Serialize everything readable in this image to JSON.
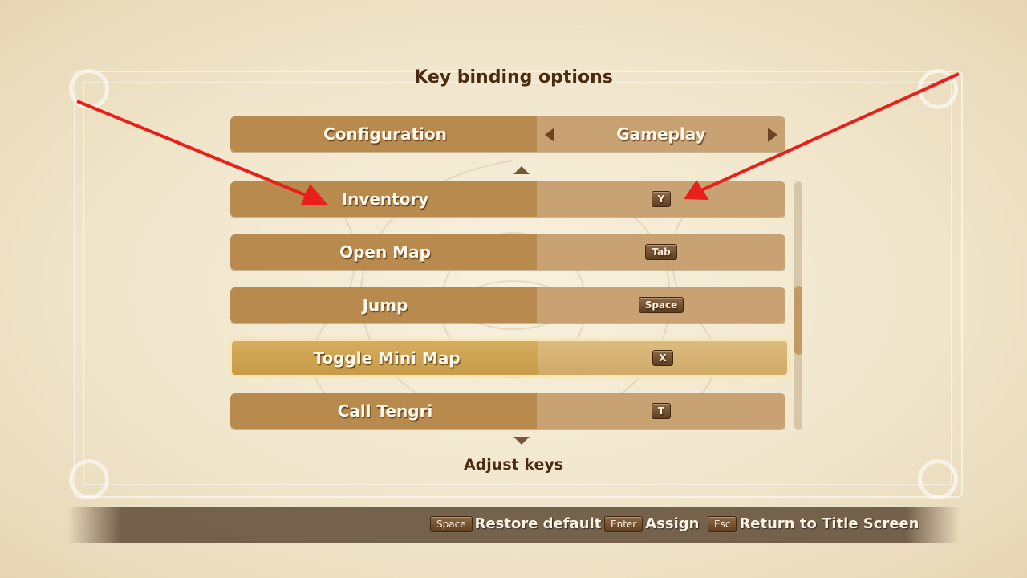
{
  "title": "Key binding options",
  "config": {
    "label": "Configuration",
    "value": "Gameplay"
  },
  "bindings": [
    {
      "action": "Inventory",
      "key": "Y"
    },
    {
      "action": "Open Map",
      "key": "Tab"
    },
    {
      "action": "Jump",
      "key": "Space"
    },
    {
      "action": "Toggle Mini Map",
      "key": "X"
    },
    {
      "action": "Call Tengri",
      "key": "T"
    }
  ],
  "selected_index": 3,
  "footer_label": "Adjust keys",
  "hints": [
    {
      "key": "Space",
      "label": "Restore default"
    },
    {
      "key": "Enter",
      "label": "Assign"
    },
    {
      "key": "Esc",
      "label": "Return to Title Screen"
    }
  ],
  "colors": {
    "accent_arrow": "#e8201c",
    "bar_dark": "#b88a4e",
    "bar_light": "#c8a273"
  }
}
